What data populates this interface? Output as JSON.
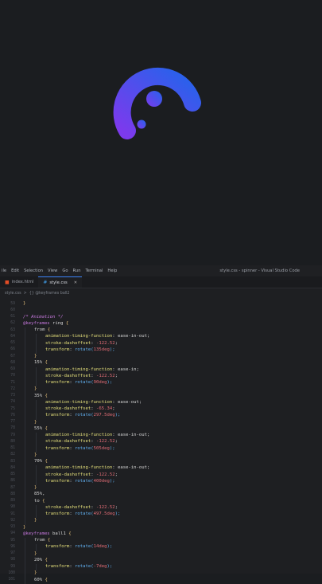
{
  "menu": [
    "ile",
    "Edit",
    "Selection",
    "View",
    "Go",
    "Run",
    "Terminal",
    "Help"
  ],
  "window_title": "style.css - spinner - Visual Studio Code",
  "tabs": [
    {
      "label": "index.html",
      "icon": "html-file-icon",
      "active": false
    },
    {
      "label": "style.css",
      "icon": "css-file-icon",
      "active": true
    }
  ],
  "breadcrumb": [
    "style.css",
    ">",
    "{} @keyframes ball2"
  ],
  "colors": {
    "gradient_start": "#7c3aed",
    "gradient_end": "#2563eb",
    "keyword": "#c678dd",
    "comment": "#c678dd",
    "property": "#e5e07b",
    "value": "#d4d4d4",
    "number": "#e06c75",
    "func": "#61afef",
    "brace": "#e5c07b"
  },
  "code_lines": [
    {
      "n": "59",
      "t": [
        [
          "}",
          "brace"
        ]
      ],
      "i": 0
    },
    {
      "n": "60",
      "t": [],
      "i": 0
    },
    {
      "n": "61",
      "t": [
        [
          "/* Animation */",
          "comment"
        ]
      ],
      "i": 0
    },
    {
      "n": "62",
      "t": [
        [
          "@keyframes ",
          "keyword"
        ],
        [
          "ring",
          "plain"
        ],
        [
          " {",
          "brace"
        ]
      ],
      "i": 0
    },
    {
      "n": "63",
      "t": [
        [
          "from",
          "plain"
        ],
        [
          " {",
          "brace"
        ]
      ],
      "i": 1
    },
    {
      "n": "64",
      "t": [
        [
          "animation-timing-function",
          "property"
        ],
        [
          ": ",
          "plain"
        ],
        [
          "ease-in-out",
          "value"
        ],
        [
          ";",
          "plain"
        ]
      ],
      "i": 2
    },
    {
      "n": "65",
      "t": [
        [
          "stroke-dashoffset",
          "property"
        ],
        [
          ": ",
          "plain"
        ],
        [
          "-122.52",
          "number"
        ],
        [
          ";",
          "plain"
        ]
      ],
      "i": 2
    },
    {
      "n": "66",
      "t": [
        [
          "transform",
          "property"
        ],
        [
          ": ",
          "plain"
        ],
        [
          "rotate(",
          "func"
        ],
        [
          "135deg",
          "number"
        ],
        [
          ");",
          "func"
        ]
      ],
      "i": 2
    },
    {
      "n": "67",
      "t": [
        [
          "}",
          "brace"
        ]
      ],
      "i": 1
    },
    {
      "n": "68",
      "t": [
        [
          "15%",
          "plain"
        ],
        [
          " {",
          "brace"
        ]
      ],
      "i": 1
    },
    {
      "n": "69",
      "t": [
        [
          "animation-timing-function",
          "property"
        ],
        [
          ": ",
          "plain"
        ],
        [
          "ease-in",
          "value"
        ],
        [
          ";",
          "plain"
        ]
      ],
      "i": 2
    },
    {
      "n": "70",
      "t": [
        [
          "stroke-dashoffset",
          "property"
        ],
        [
          ": ",
          "plain"
        ],
        [
          "-122.52",
          "number"
        ],
        [
          ";",
          "plain"
        ]
      ],
      "i": 2
    },
    {
      "n": "71",
      "t": [
        [
          "transform",
          "property"
        ],
        [
          ": ",
          "plain"
        ],
        [
          "rotate(",
          "func"
        ],
        [
          "90deg",
          "number"
        ],
        [
          ");",
          "func"
        ]
      ],
      "i": 2
    },
    {
      "n": "72",
      "t": [
        [
          "}",
          "brace"
        ]
      ],
      "i": 1
    },
    {
      "n": "73",
      "t": [
        [
          "35%",
          "plain"
        ],
        [
          " {",
          "brace"
        ]
      ],
      "i": 1
    },
    {
      "n": "74",
      "t": [
        [
          "animation-timing-function",
          "property"
        ],
        [
          ": ",
          "plain"
        ],
        [
          "ease-out",
          "value"
        ],
        [
          ";",
          "plain"
        ]
      ],
      "i": 2
    },
    {
      "n": "75",
      "t": [
        [
          "stroke-dashoffset",
          "property"
        ],
        [
          ": ",
          "plain"
        ],
        [
          "-65.34",
          "number"
        ],
        [
          ";",
          "plain"
        ]
      ],
      "i": 2
    },
    {
      "n": "76",
      "t": [
        [
          "transform",
          "property"
        ],
        [
          ": ",
          "plain"
        ],
        [
          "rotate(",
          "func"
        ],
        [
          "297.5deg",
          "number"
        ],
        [
          ");",
          "func"
        ]
      ],
      "i": 2
    },
    {
      "n": "77",
      "t": [
        [
          "}",
          "brace"
        ]
      ],
      "i": 1
    },
    {
      "n": "78",
      "t": [
        [
          "55%",
          "plain"
        ],
        [
          " {",
          "brace"
        ]
      ],
      "i": 1
    },
    {
      "n": "79",
      "t": [
        [
          "animation-timing-function",
          "property"
        ],
        [
          ": ",
          "plain"
        ],
        [
          "ease-in-out",
          "value"
        ],
        [
          ";",
          "plain"
        ]
      ],
      "i": 2
    },
    {
      "n": "80",
      "t": [
        [
          "stroke-dashoffset",
          "property"
        ],
        [
          ": ",
          "plain"
        ],
        [
          "-122.52",
          "number"
        ],
        [
          ";",
          "plain"
        ]
      ],
      "i": 2
    },
    {
      "n": "81",
      "t": [
        [
          "transform",
          "property"
        ],
        [
          ": ",
          "plain"
        ],
        [
          "rotate(",
          "func"
        ],
        [
          "505deg",
          "number"
        ],
        [
          ");",
          "func"
        ]
      ],
      "i": 2
    },
    {
      "n": "82",
      "t": [
        [
          "}",
          "brace"
        ]
      ],
      "i": 1
    },
    {
      "n": "83",
      "t": [
        [
          "70%",
          "plain"
        ],
        [
          " {",
          "brace"
        ]
      ],
      "i": 1
    },
    {
      "n": "84",
      "t": [
        [
          "animation-timing-function",
          "property"
        ],
        [
          ": ",
          "plain"
        ],
        [
          "ease-in-out",
          "value"
        ],
        [
          ";",
          "plain"
        ]
      ],
      "i": 2
    },
    {
      "n": "85",
      "t": [
        [
          "stroke-dashoffset",
          "property"
        ],
        [
          ": ",
          "plain"
        ],
        [
          "-122.52",
          "number"
        ],
        [
          ";",
          "plain"
        ]
      ],
      "i": 2
    },
    {
      "n": "86",
      "t": [
        [
          "transform",
          "property"
        ],
        [
          ": ",
          "plain"
        ],
        [
          "rotate(",
          "func"
        ],
        [
          "400deg",
          "number"
        ],
        [
          ");",
          "func"
        ]
      ],
      "i": 2
    },
    {
      "n": "87",
      "t": [
        [
          "}",
          "brace"
        ]
      ],
      "i": 1
    },
    {
      "n": "88",
      "t": [
        [
          "85%,",
          "plain"
        ]
      ],
      "i": 1
    },
    {
      "n": "89",
      "t": [
        [
          "to",
          "plain"
        ],
        [
          " {",
          "brace"
        ]
      ],
      "i": 1
    },
    {
      "n": "90",
      "t": [
        [
          "stroke-dashoffset",
          "property"
        ],
        [
          ": ",
          "plain"
        ],
        [
          "-122.52",
          "number"
        ],
        [
          ";",
          "plain"
        ]
      ],
      "i": 2
    },
    {
      "n": "91",
      "t": [
        [
          "transform",
          "property"
        ],
        [
          ": ",
          "plain"
        ],
        [
          "rotate(",
          "func"
        ],
        [
          "497.5deg",
          "number"
        ],
        [
          ");",
          "func"
        ]
      ],
      "i": 2
    },
    {
      "n": "92",
      "t": [
        [
          "}",
          "brace"
        ]
      ],
      "i": 1
    },
    {
      "n": "93",
      "t": [
        [
          "}",
          "brace"
        ]
      ],
      "i": 0
    },
    {
      "n": "94",
      "t": [
        [
          "@keyframes ",
          "keyword"
        ],
        [
          "ball1",
          "plain"
        ],
        [
          " {",
          "brace"
        ]
      ],
      "i": 0
    },
    {
      "n": "95",
      "t": [
        [
          "from",
          "plain"
        ],
        [
          " {",
          "brace"
        ]
      ],
      "i": 1
    },
    {
      "n": "96",
      "t": [
        [
          "transform",
          "property"
        ],
        [
          ": ",
          "plain"
        ],
        [
          "rotate(",
          "func"
        ],
        [
          "14deg",
          "number"
        ],
        [
          ");",
          "func"
        ]
      ],
      "i": 2
    },
    {
      "n": "97",
      "t": [
        [
          "}",
          "brace"
        ]
      ],
      "i": 1
    },
    {
      "n": "98",
      "t": [
        [
          "20%",
          "plain"
        ],
        [
          " {",
          "brace"
        ]
      ],
      "i": 1
    },
    {
      "n": "99",
      "t": [
        [
          "transform",
          "property"
        ],
        [
          ": ",
          "plain"
        ],
        [
          "rotate(",
          "func"
        ],
        [
          "-7deg",
          "number"
        ],
        [
          ");",
          "func"
        ]
      ],
      "i": 2
    },
    {
      "n": "100",
      "t": [
        [
          "}",
          "brace"
        ]
      ],
      "i": 1
    },
    {
      "n": "101",
      "t": [
        [
          "60%",
          "plain"
        ],
        [
          " {",
          "brace"
        ]
      ],
      "i": 1
    }
  ]
}
